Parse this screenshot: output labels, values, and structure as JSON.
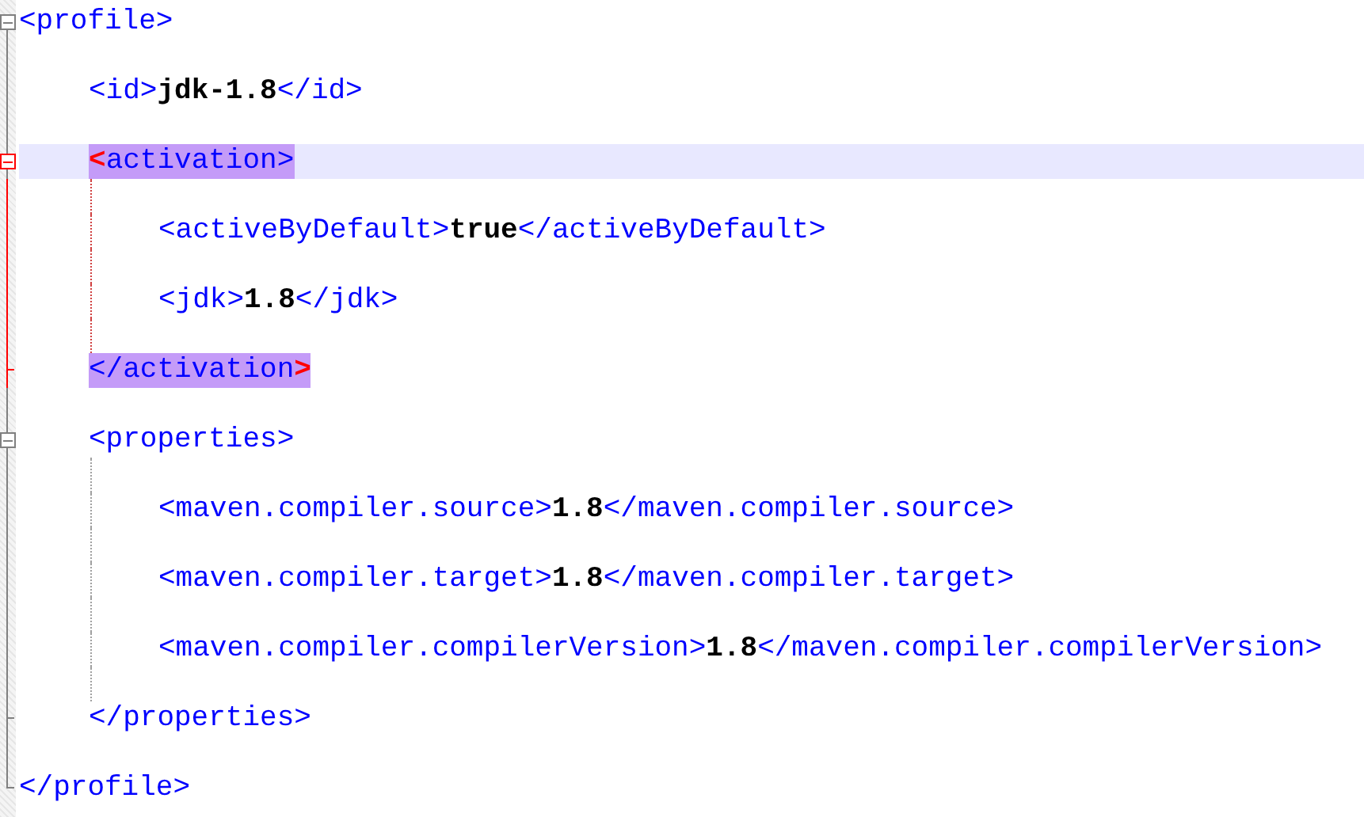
{
  "editor": {
    "nodes": [
      {
        "open": "<profile>",
        "close": "</profile>",
        "selected": false,
        "children": [
          {
            "open": "<id>",
            "value": "jdk-1.8",
            "close": "</id>"
          },
          {
            "open": "<activation>",
            "close": "</activation>",
            "selected": true,
            "children": [
              {
                "open": "<activeByDefault>",
                "value": "true",
                "close": "</activeByDefault>"
              },
              {
                "open": "<jdk>",
                "value": "1.8",
                "close": "</jdk>"
              }
            ]
          },
          {
            "open": "<properties>",
            "close": "</properties>",
            "selected": false,
            "children": [
              {
                "open": "<maven.compiler.source>",
                "value": "1.8",
                "close": "</maven.compiler.source>"
              },
              {
                "open": "<maven.compiler.target>",
                "value": "1.8",
                "close": "</maven.compiler.target>"
              },
              {
                "open": "<maven.compiler.compilerVersion>",
                "value": "1.8",
                "close": "</maven.compiler.compilerVersion>"
              }
            ]
          }
        ]
      }
    ]
  }
}
